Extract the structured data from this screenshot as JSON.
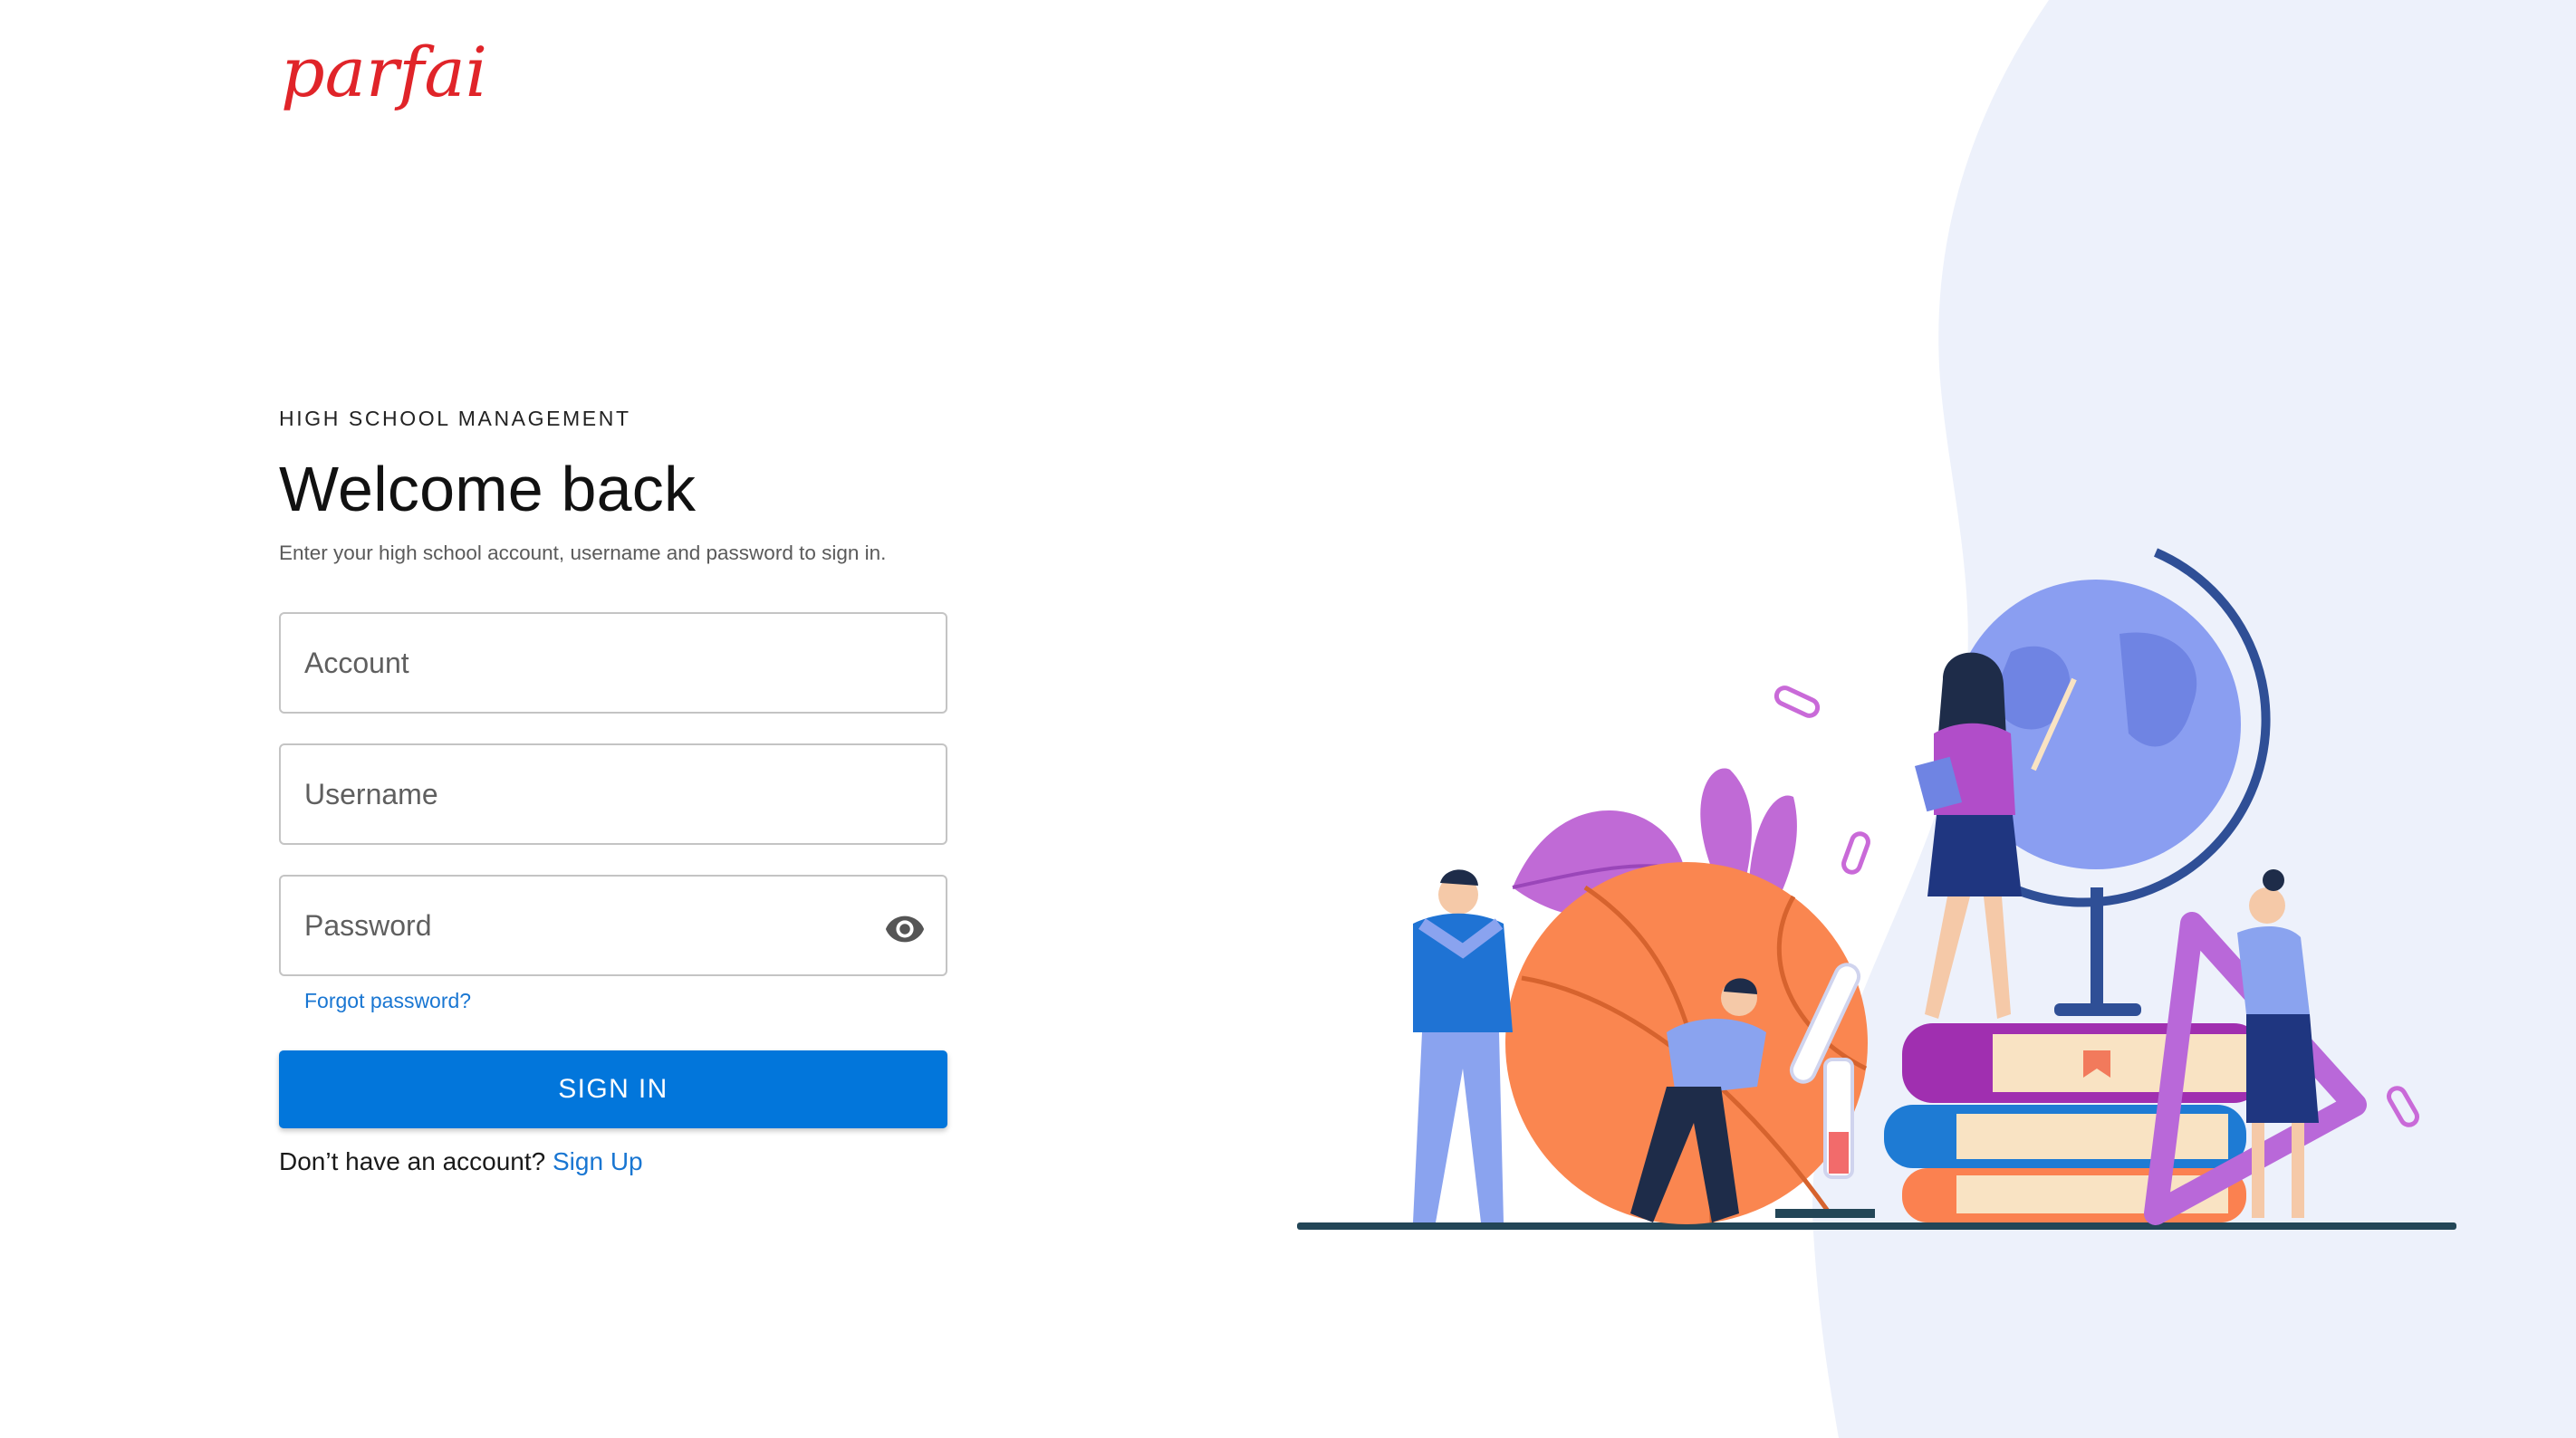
{
  "brand": {
    "logo_text": "parfait",
    "logo_color": "#e02429"
  },
  "login": {
    "overline": "HIGH SCHOOL MANAGEMENT",
    "title": "Welcome back",
    "subtitle": "Enter your high school account, username and password to sign in.",
    "account_placeholder": "Account",
    "username_placeholder": "Username",
    "password_placeholder": "Password",
    "password_toggle_icon": "eye-icon",
    "forgot_label": "Forgot password?",
    "signin_label": "SIGN IN",
    "signup_prompt": "Don’t have an account?",
    "signup_link": "Sign Up"
  },
  "colors": {
    "primary": "#0276db",
    "link": "#1976d2",
    "blob": "#edf1fb"
  }
}
